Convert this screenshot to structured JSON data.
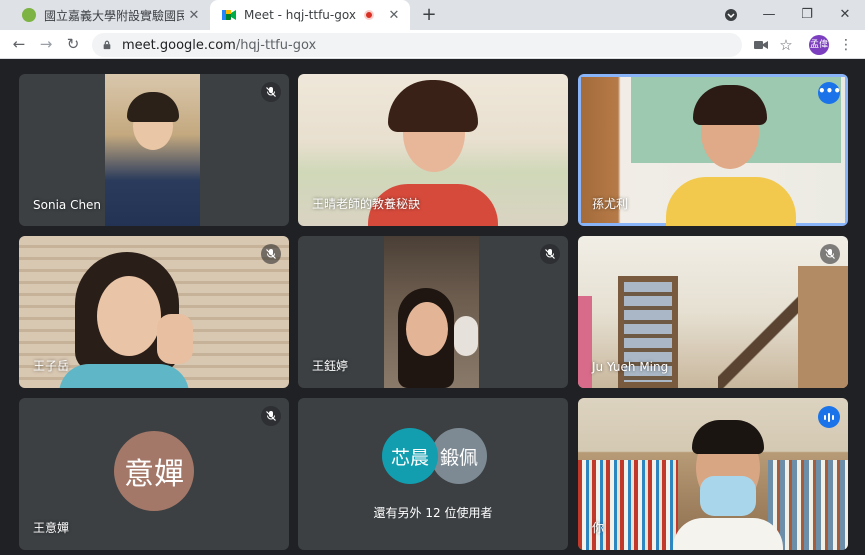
{
  "browser": {
    "tabs": [
      {
        "title": "國立嘉義大學附設實驗國民小學",
        "favicon_color": "#7cb342",
        "close": "✕"
      },
      {
        "title": "Meet - hqj-ttfu-gox",
        "favicon_color": "#00832d",
        "close": "✕",
        "recording": true
      }
    ],
    "new_tab": "+",
    "window_controls": {
      "minimize": "—",
      "maximize": "❐",
      "close": "✕"
    },
    "address": {
      "host": "meet.google.com",
      "path": "/hqj-ttfu-gox"
    },
    "profile_initials": "孟偉",
    "menu": "⋮",
    "nav": {
      "back": "←",
      "forward": "→",
      "reload": "↻"
    }
  },
  "meeting": {
    "tiles": [
      {
        "name": "Sonia Chen",
        "status": "muted"
      },
      {
        "name": "王晴老師的教養秘訣",
        "status": "none"
      },
      {
        "name": "孫尤利",
        "status": "more",
        "more_label": "•••"
      },
      {
        "name": "王子岳",
        "status": "muted"
      },
      {
        "name": "王鈺婷",
        "status": "muted"
      },
      {
        "name": "Ju Yueh Ming",
        "status": "muted"
      },
      {
        "name": "王意嬋",
        "status": "muted",
        "avatar_text": "意嬋",
        "avatar_color": "#a47868"
      },
      {
        "name": "",
        "status": "none",
        "group": [
          {
            "text": "芯晨",
            "color": "#129eaf"
          },
          {
            "text": "鍛佩",
            "color": "#7d8a93"
          }
        ],
        "others_text": "還有另外 12 位使用者"
      },
      {
        "name": "你",
        "status": "speaking"
      }
    ]
  }
}
